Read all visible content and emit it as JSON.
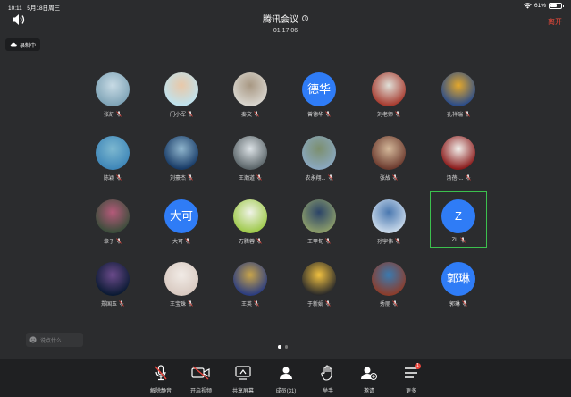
{
  "status_bar": {
    "time": "10:11",
    "date": "5月18日周三",
    "battery": "61%"
  },
  "header": {
    "title": "腾讯会议",
    "timer": "01:17:06",
    "leave_label": "离开"
  },
  "recording": {
    "label": "录制中"
  },
  "participants": [
    {
      "name": "张舒",
      "colors": [
        "#7ea3b6",
        "#c8dbe5"
      ]
    },
    {
      "name": "门小军",
      "colors": [
        "#bfe3ef",
        "#e9c8a8"
      ]
    },
    {
      "name": "秦文",
      "colors": [
        "#d9d6cf",
        "#a89883"
      ]
    },
    {
      "name": "曾德华",
      "avatar_text": "德华"
    },
    {
      "name": "刘老师",
      "colors": [
        "#a63a2e",
        "#e0e0d8"
      ]
    },
    {
      "name": "孔祥瑞",
      "colors": [
        "#2a4c8a",
        "#e4a82b"
      ]
    },
    {
      "name": "陈颖",
      "colors": [
        "#3e86b8",
        "#7db8d0"
      ]
    },
    {
      "name": "刘豪杰",
      "colors": [
        "#173a66",
        "#8fb5cd"
      ]
    },
    {
      "name": "王瀚道",
      "colors": [
        "#5a6468",
        "#dce2e6"
      ]
    },
    {
      "name": "农永翔...",
      "colors": [
        "#8aa8c0",
        "#7c8f6e"
      ]
    },
    {
      "name": "张故",
      "colors": [
        "#6b3a2e",
        "#d4b89a"
      ]
    },
    {
      "name": "汤蓓-...",
      "colors": [
        "#8a1a1a",
        "#f2f0ec"
      ]
    },
    {
      "name": "章子",
      "colors": [
        "#3a4d3a",
        "#b55a7a"
      ]
    },
    {
      "name": "大可",
      "avatar_text": "大可"
    },
    {
      "name": "万腾蓉",
      "colors": [
        "#9ec94a",
        "#f0f3e8"
      ]
    },
    {
      "name": "王甲旬",
      "colors": [
        "#8c9d6a",
        "#2b4468"
      ]
    },
    {
      "name": "孙宇伟",
      "colors": [
        "#c9d9ea",
        "#4a78b0"
      ]
    },
    {
      "name": "ZL",
      "avatar_text": "Z"
    },
    {
      "name": "郑国玉",
      "colors": [
        "#0a1a33",
        "#6a4a8a"
      ]
    },
    {
      "name": "王宝珠",
      "colors": [
        "#d8c9c0",
        "#f1ebe6"
      ]
    },
    {
      "name": "王英",
      "colors": [
        "#2a3c80",
        "#c8a44a"
      ]
    },
    {
      "name": "于新娟",
      "colors": [
        "#2a2a2a",
        "#f0c040"
      ]
    },
    {
      "name": "秀丽",
      "colors": [
        "#8c3c2a",
        "#3a7ab0"
      ]
    },
    {
      "name": "郭琳",
      "avatar_text": "郭琳"
    }
  ],
  "chat": {
    "placeholder": "说点什么..."
  },
  "toolbar": {
    "unmute": "解除静音",
    "start_video": "开启视频",
    "share_screen": "共享屏幕",
    "members": "成员(31)",
    "raise_hand": "举手",
    "invite": "邀请",
    "more": "更多",
    "more_badge": "1"
  },
  "colors": {
    "background": "#2b2c2e",
    "toolbar": "#1f2022",
    "accent": "#2f7cf6",
    "leave": "#f04a3a",
    "highlight": "#3cc04e"
  }
}
